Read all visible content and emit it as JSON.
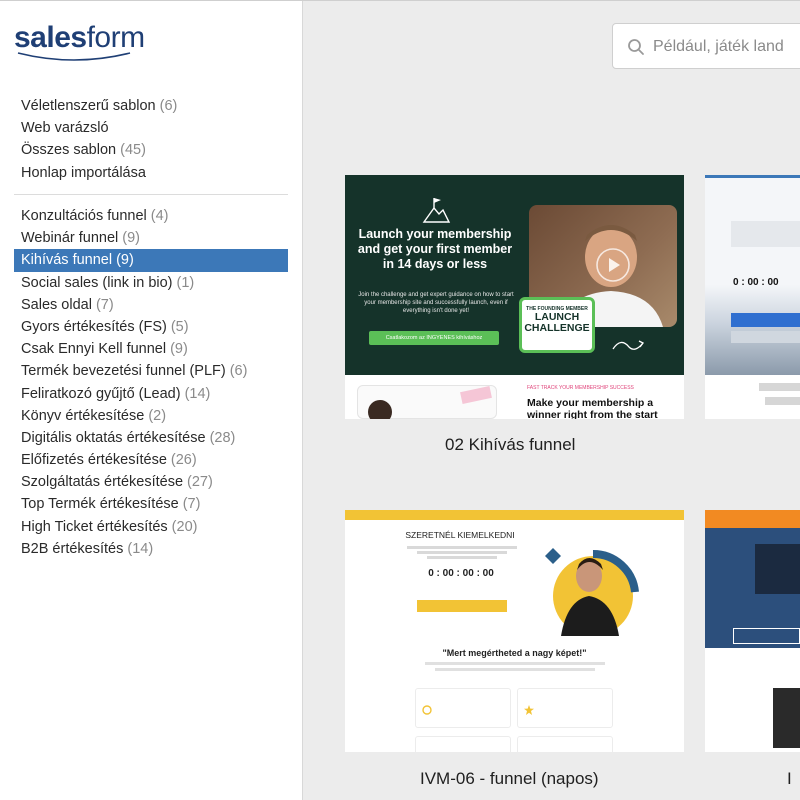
{
  "logo": {
    "brand": "salesform"
  },
  "search": {
    "placeholder": "Például, játék land"
  },
  "menu_top": [
    {
      "label": "Véletlenszerű sablon",
      "count": "(6)"
    },
    {
      "label": "Web varázsló",
      "count": ""
    },
    {
      "label": "Összes sablon",
      "count": "(45)"
    },
    {
      "label": "Honlap importálása",
      "count": ""
    }
  ],
  "menu_categories": [
    {
      "label": "Konzultációs funnel",
      "count": "(4)"
    },
    {
      "label": "Webinár funnel",
      "count": "(9)"
    },
    {
      "label": "Kihívás funnel",
      "count": "(9)",
      "active": true
    },
    {
      "label": "Social sales (link in bio)",
      "count": "(1)"
    },
    {
      "label": "Sales oldal",
      "count": "(7)"
    },
    {
      "label": "Gyors értékesítés (FS)",
      "count": "(5)"
    },
    {
      "label": "Csak Ennyi Kell funnel",
      "count": "(9)"
    },
    {
      "label": "Termék bevezetési funnel (PLF)",
      "count": "(6)"
    },
    {
      "label": "Feliratkozó gyűjtő (Lead)",
      "count": "(14)"
    },
    {
      "label": "Könyv értékesítése",
      "count": "(2)"
    },
    {
      "label": "Digitális oktatás értékesítése",
      "count": "(28)"
    },
    {
      "label": "Előfizetés értékesítése",
      "count": "(26)"
    },
    {
      "label": "Szolgáltatás értékesítése",
      "count": "(27)"
    },
    {
      "label": "Top Termék értékesítése",
      "count": "(7)"
    },
    {
      "label": "High Ticket értékesítés",
      "count": "(20)"
    },
    {
      "label": "B2B értékesítés",
      "count": "(14)"
    }
  ],
  "cards": [
    {
      "label": "02 Kihívás funnel",
      "preview": {
        "headline": "Launch your membership and get your first member in 14 days or less",
        "description": "Join the challenge and get expert guidance on how to start your membership site and successfully launch, even if everything isn't done yet!",
        "cta": "Csatlakozom az INGYENES kihíváshoz",
        "badge_small": "THE FOUNDING MEMBER",
        "badge_big": "LAUNCH CHALLENGE",
        "section_kicker": "FAST TRACK YOUR MEMBERSHIP SUCCESS",
        "section_title": "Make your membership a winner right from the start"
      }
    },
    {
      "label": "IVM-06 - funnel (napos)",
      "preview": {
        "heading": "SZERETNÉL KIEMELKEDNI",
        "counter": "0 : 00 : 00 : 00",
        "quote": "\"Mert megértheted a nagy képet!\""
      }
    },
    {
      "label": "I"
    }
  ],
  "colors": {
    "accent": "#3c78b8",
    "brand": "#1f3f75",
    "challenge_bg": "#15332a",
    "challenge_green": "#5bbf57",
    "ivm_yellow": "#f2c335"
  }
}
